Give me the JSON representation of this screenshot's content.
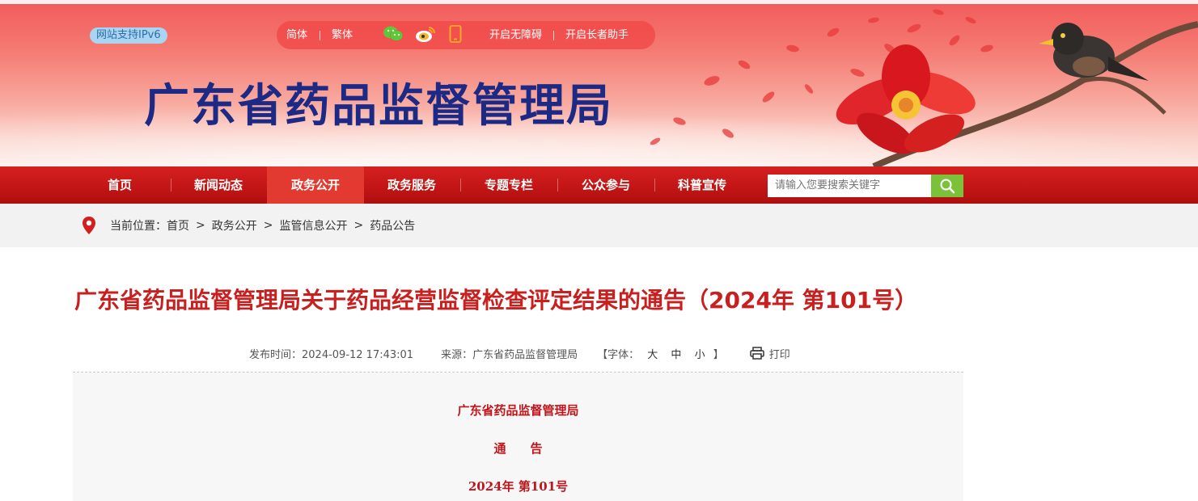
{
  "header": {
    "ipv6_badge": "网站支持IPv6",
    "toolbar": {
      "simplified": "简体",
      "traditional": "繁体",
      "accessibility": "开启无障碍",
      "elder_mode": "开启长者助手",
      "icons": [
        "wechat-icon",
        "weibo-icon",
        "mobile-icon"
      ]
    },
    "site_title": "广东省药品监督管理局"
  },
  "nav": {
    "items": [
      {
        "label": "首页"
      },
      {
        "label": "新闻动态"
      },
      {
        "label": "政务公开",
        "active": true
      },
      {
        "label": "政务服务"
      },
      {
        "label": "专题专栏"
      },
      {
        "label": "公众参与"
      },
      {
        "label": "科普宣传"
      }
    ],
    "search_placeholder": "请输入您要搜索关键字"
  },
  "breadcrumb": {
    "prefix": "当前位置：",
    "items": [
      "首页",
      "政务公开",
      "监管信息公开",
      "药品公告"
    ],
    "separator": ">"
  },
  "article": {
    "title": "广东省药品监督管理局关于药品经营监督检查评定结果的通告（2024年 第101号）",
    "publish_time": "发布时间：2024-09-12 17:43:01",
    "source": "来源：广东省药品监督管理局",
    "font_size": {
      "label_open": "【字体：",
      "large": "大",
      "medium": "中",
      "small": "小",
      "label_close": "】"
    },
    "print_label": "打印",
    "body_lines": [
      "广东省药品监督管理局",
      "通　　告",
      "2024年 第101号"
    ]
  },
  "colors": {
    "nav_red": "#c11515",
    "nav_active": "#e23a30",
    "title_red": "#c81f1f",
    "site_title_blue": "#1c2a85",
    "search_green": "#7cc13a"
  }
}
